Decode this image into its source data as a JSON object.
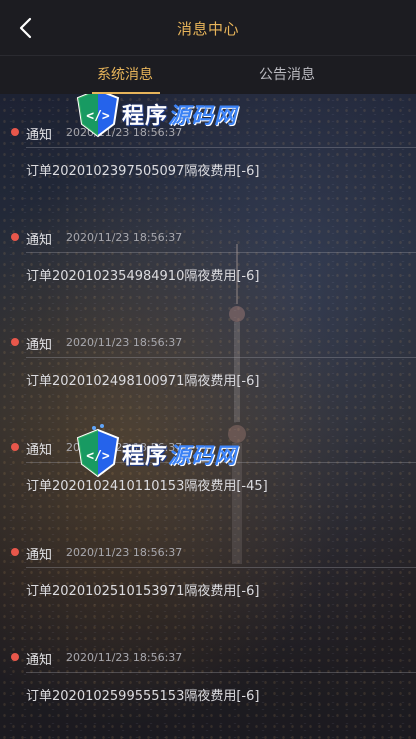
{
  "header": {
    "title": "消息中心"
  },
  "tabs": [
    {
      "label": "系统消息",
      "active": true
    },
    {
      "label": "公告消息",
      "active": false
    }
  ],
  "messages": [
    {
      "type": "通知",
      "time": "2020/11/23 18:56:37",
      "body": "订单2020102397505097隔夜费用[-6]"
    },
    {
      "type": "通知",
      "time": "2020/11/23 18:56:37",
      "body": "订单2020102354984910隔夜费用[-6]"
    },
    {
      "type": "通知",
      "time": "2020/11/23 18:56:37",
      "body": "订单2020102498100971隔夜费用[-6]"
    },
    {
      "type": "通知",
      "time": "2020/11/23 18:56:37",
      "body": "订单2020102410110153隔夜费用[-45]"
    },
    {
      "type": "通知",
      "time": "2020/11/23 18:56:37",
      "body": "订单2020102510153971隔夜费用[-6]"
    },
    {
      "type": "通知",
      "time": "2020/11/23 18:56:37",
      "body": "订单2020102599555153隔夜费用[-6]"
    }
  ],
  "watermark": {
    "text_part1": "程序",
    "text_part2": "源码网"
  },
  "colors": {
    "accent": "#e7b45a",
    "dot": "#e8574b"
  }
}
